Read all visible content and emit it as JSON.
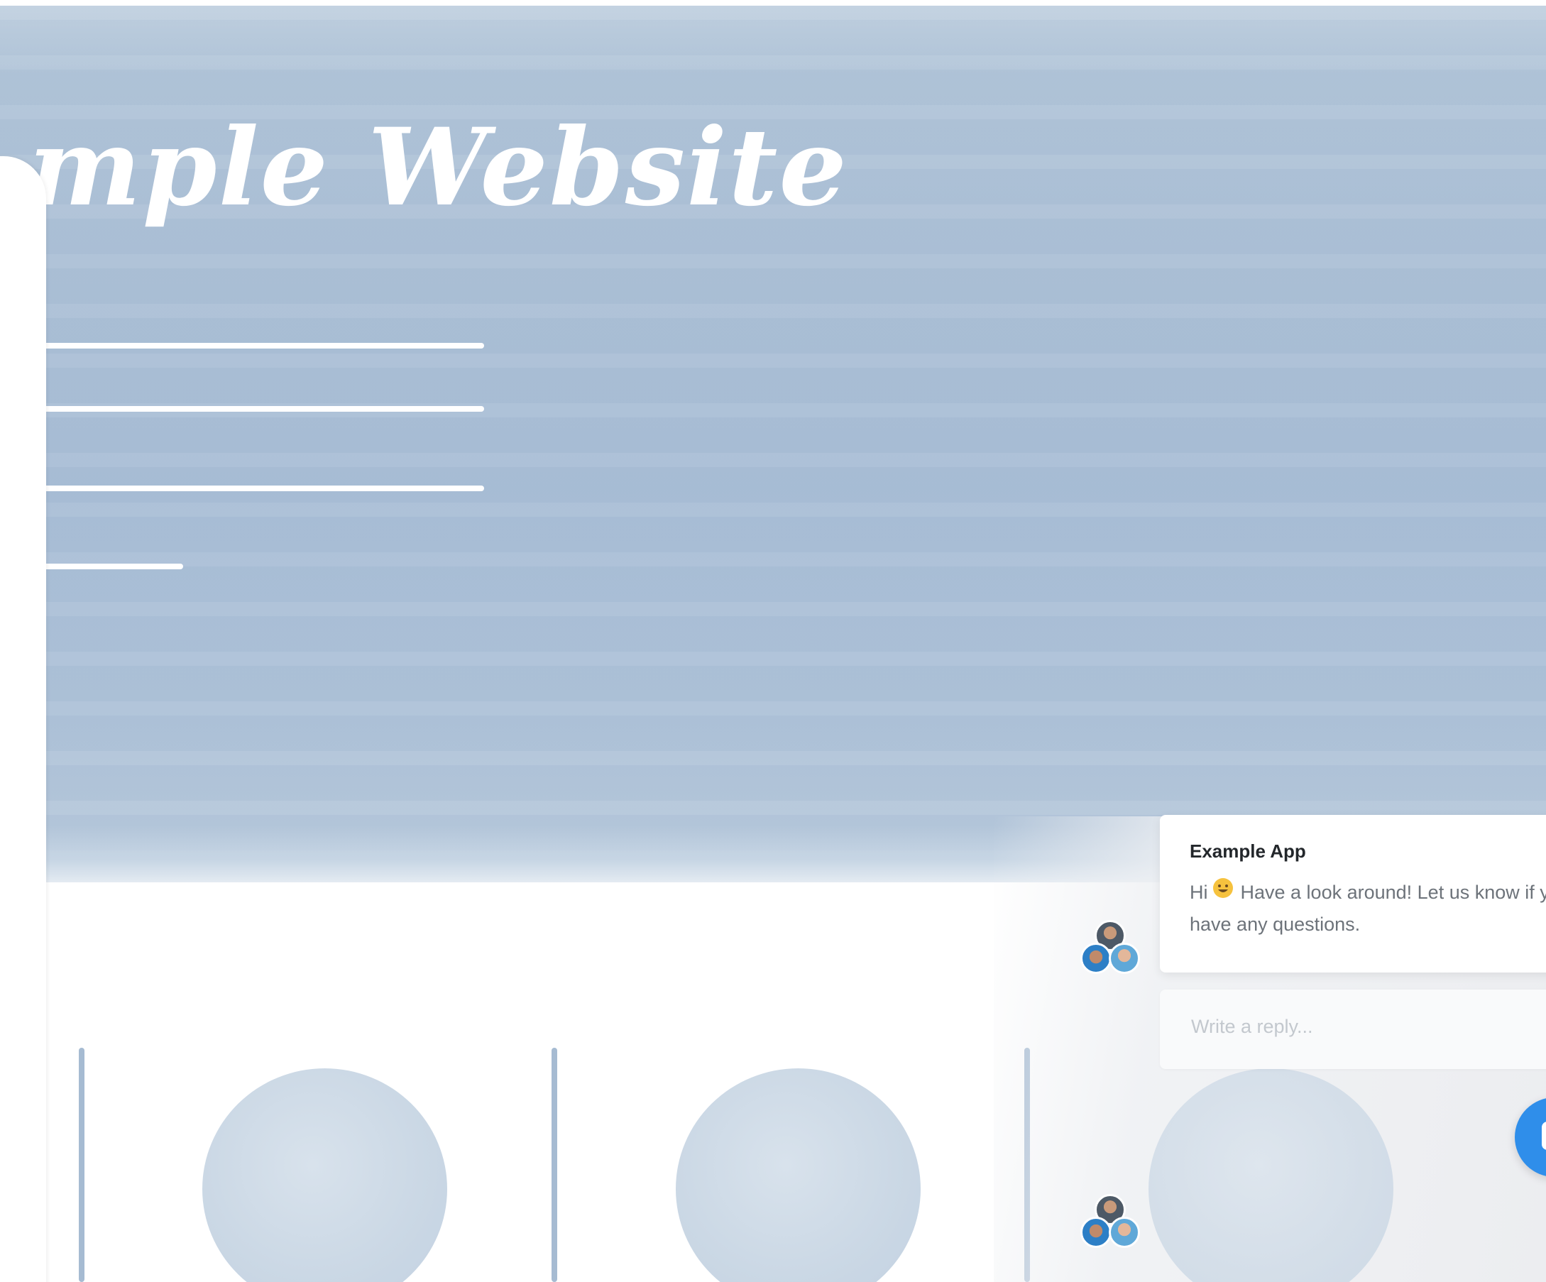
{
  "hero": {
    "title": "mple Website"
  },
  "chat": {
    "app_name": "Example App",
    "greeting": "Hi",
    "emoji_icon": "smiley-emoji-icon",
    "message": "Have a look around! Let us know if you have any questions.",
    "reply_placeholder": "Write a reply..."
  },
  "colors": {
    "hero_blue": "#acc0d6",
    "accent_blue": "#3f99f0",
    "launcher_blue": "#2f8eea",
    "bar_blue": "#a6bbd2"
  }
}
